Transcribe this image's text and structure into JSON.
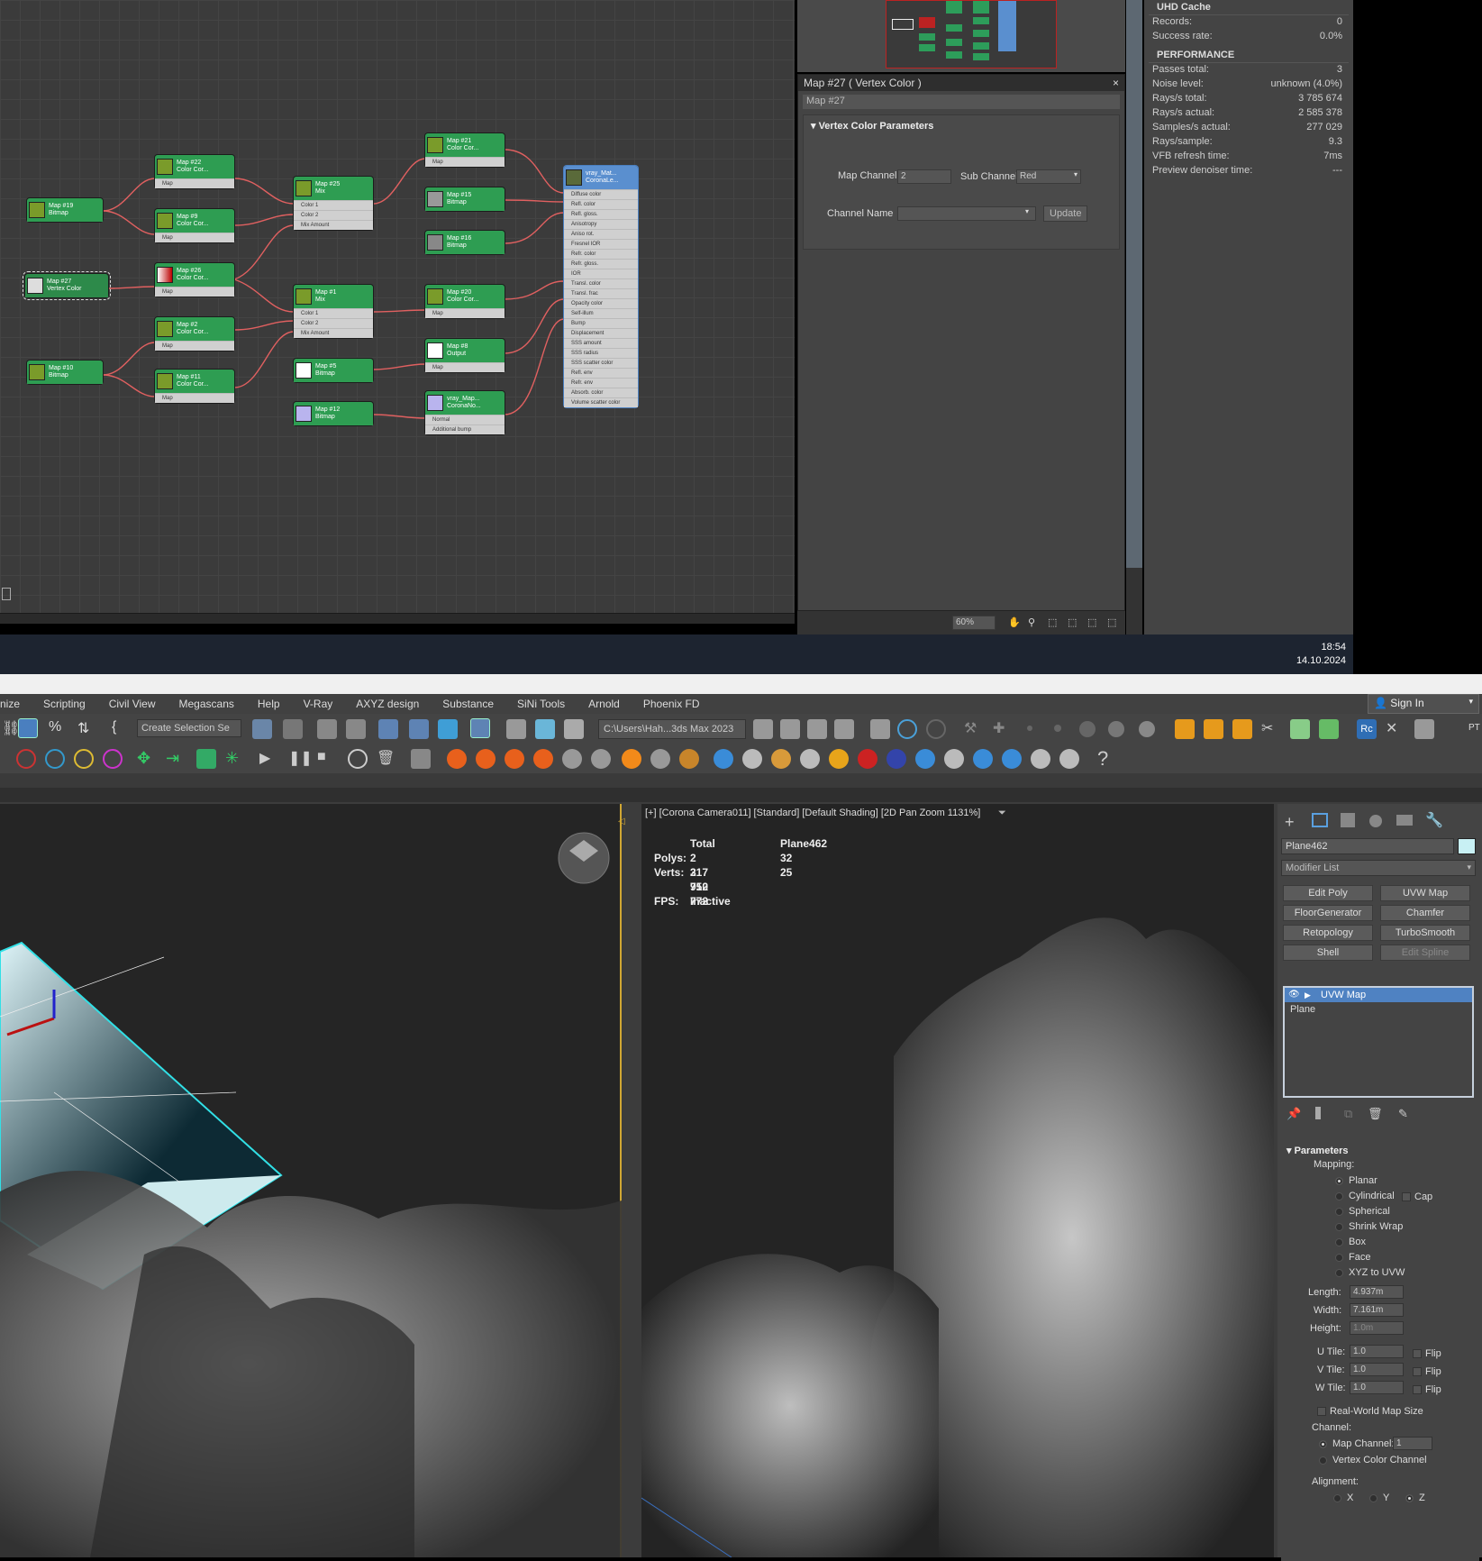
{
  "slate": {
    "nodes": [
      {
        "label1": "Map #19",
        "label2": "Bitmap"
      },
      {
        "label1": "Map #22",
        "label2": "Color Cor..."
      },
      {
        "label1": "Map #9",
        "label2": "Color Cor..."
      },
      {
        "label1": "Map #27",
        "label2": "Vertex Color"
      },
      {
        "label1": "Map #26",
        "label2": "Color Cor..."
      },
      {
        "label1": "Map #2",
        "label2": "Color Cor..."
      },
      {
        "label1": "Map #10",
        "label2": "Bitmap"
      },
      {
        "label1": "Map #11",
        "label2": "Color Cor..."
      },
      {
        "label1": "Map #25",
        "label2": "Mix"
      },
      {
        "label1": "Map #1",
        "label2": "Mix"
      },
      {
        "label1": "Map #5",
        "label2": "Bitmap"
      },
      {
        "label1": "Map #12",
        "label2": "Bitmap"
      },
      {
        "label1": "Map #21",
        "label2": "Color Cor..."
      },
      {
        "label1": "Map #15",
        "label2": "Bitmap"
      },
      {
        "label1": "Map #16",
        "label2": "Bitmap"
      },
      {
        "label1": "Map #20",
        "label2": "Color Cor..."
      },
      {
        "label1": "Map #8",
        "label2": "Output"
      },
      {
        "label1": "vray_Map...",
        "label2": "CoronaNo..."
      },
      {
        "label1": "vray_Mat...",
        "label2": "CoronaLe..."
      }
    ],
    "slots_map": "Map",
    "slots_mix": [
      "Color 1",
      "Color 2",
      "Mix Amount"
    ],
    "slots_normal": [
      "Normal",
      "Additional bump"
    ],
    "mat_slots": [
      "Diffuse color",
      "Refl. color",
      "Refl. gloss.",
      "Anisotropy",
      "Aniso rot.",
      "Fresnel IOR",
      "Refr. color",
      "Refr. gloss.",
      "IOR",
      "Transl. color",
      "Transl. frac",
      "Opacity color",
      "Self-illum",
      "Bump",
      "Displacement",
      "SSS amount",
      "SSS radius",
      "SSS scatter color",
      "Refl. env",
      "Refr. env",
      "Absorb. color",
      "Volume scatter color"
    ]
  },
  "props": {
    "title": "Map #27  ( Vertex Color )",
    "name": "Map #27",
    "rollout": "Vertex Color Parameters",
    "map_channel_label": "Map Channel",
    "map_channel": "2",
    "sub_channel_label": "Sub Channel",
    "sub_channel": "Red",
    "channel_name_label": "Channel Name",
    "update": "Update",
    "zoom": "60%"
  },
  "vfb": {
    "uhd_title": "UHD Cache",
    "uhd_rows": [
      {
        "k": "Records:",
        "v": "0"
      },
      {
        "k": "Success rate:",
        "v": "0.0%"
      }
    ],
    "perf_title": "PERFORMANCE",
    "perf_rows": [
      {
        "k": "Passes total:",
        "v": "3"
      },
      {
        "k": "Noise level:",
        "v": "unknown (4.0%)"
      },
      {
        "k": "Rays/s total:",
        "v": "3 785 674"
      },
      {
        "k": "Rays/s actual:",
        "v": "2 585 378"
      },
      {
        "k": "Samples/s actual:",
        "v": "277 029"
      },
      {
        "k": "Rays/sample:",
        "v": "9.3"
      },
      {
        "k": "VFB refresh time:",
        "v": "7ms"
      },
      {
        "k": "Preview denoiser time:",
        "v": "---"
      }
    ]
  },
  "clock": {
    "time": "18:54",
    "date": "14.10.2024"
  },
  "menu": [
    "nize",
    "Scripting",
    "Civil View",
    "Megascans",
    "Help",
    "V-Ray",
    "AXYZ design",
    "Substance",
    "SiNi Tools",
    "Arnold",
    "Phoenix FD"
  ],
  "signin": "Sign In",
  "selection_set": "Create Selection Se",
  "project_path": "C:\\Users\\Hah...3ds Max 2023",
  "pt": "PT",
  "viewport": {
    "label": "[+] [Corona Camera011] [Standard] [Default Shading] [2D Pan Zoom 1131%]",
    "total": "Total",
    "object": "Plane462",
    "polys_label": "Polys:",
    "polys_total": "2 317 712",
    "polys_obj": "32",
    "verts_label": "Verts:",
    "verts_total": "2 950 772",
    "verts_obj": "25",
    "fps_label": "FPS:",
    "fps_value": "Inactive"
  },
  "cmd": {
    "object_name": "Plane462",
    "object_color": "#c8f0f4",
    "modifier_list": "Modifier List",
    "buttons": [
      "Edit Poly",
      "UVW Map",
      "FloorGenerator",
      "Chamfer",
      "Retopology",
      "TurboSmooth",
      "Shell",
      "Edit Spline"
    ],
    "stack": [
      "UVW Map",
      "Plane"
    ],
    "params_title": "Parameters",
    "mapping_label": "Mapping:",
    "mapping": [
      "Planar",
      "Cylindrical",
      "Spherical",
      "Shrink Wrap",
      "Box",
      "Face",
      "XYZ to UVW"
    ],
    "cap": "Cap",
    "length_label": "Length:",
    "length": "4.937m",
    "width_label": "Width:",
    "width": "7.161m",
    "height_label": "Height:",
    "height": "1.0m",
    "utile_label": "U Tile:",
    "utile": "1.0",
    "vtile_label": "V Tile:",
    "vtile": "1.0",
    "wtile_label": "W Tile:",
    "wtile": "1.0",
    "flip": "Flip",
    "realworld": "Real-World Map Size",
    "channel_label": "Channel:",
    "map_channel_label": "Map Channel:",
    "map_channel": "1",
    "vertex_color_channel": "Vertex Color Channel",
    "alignment_label": "Alignment:",
    "axes": [
      "X",
      "Y",
      "Z"
    ]
  }
}
